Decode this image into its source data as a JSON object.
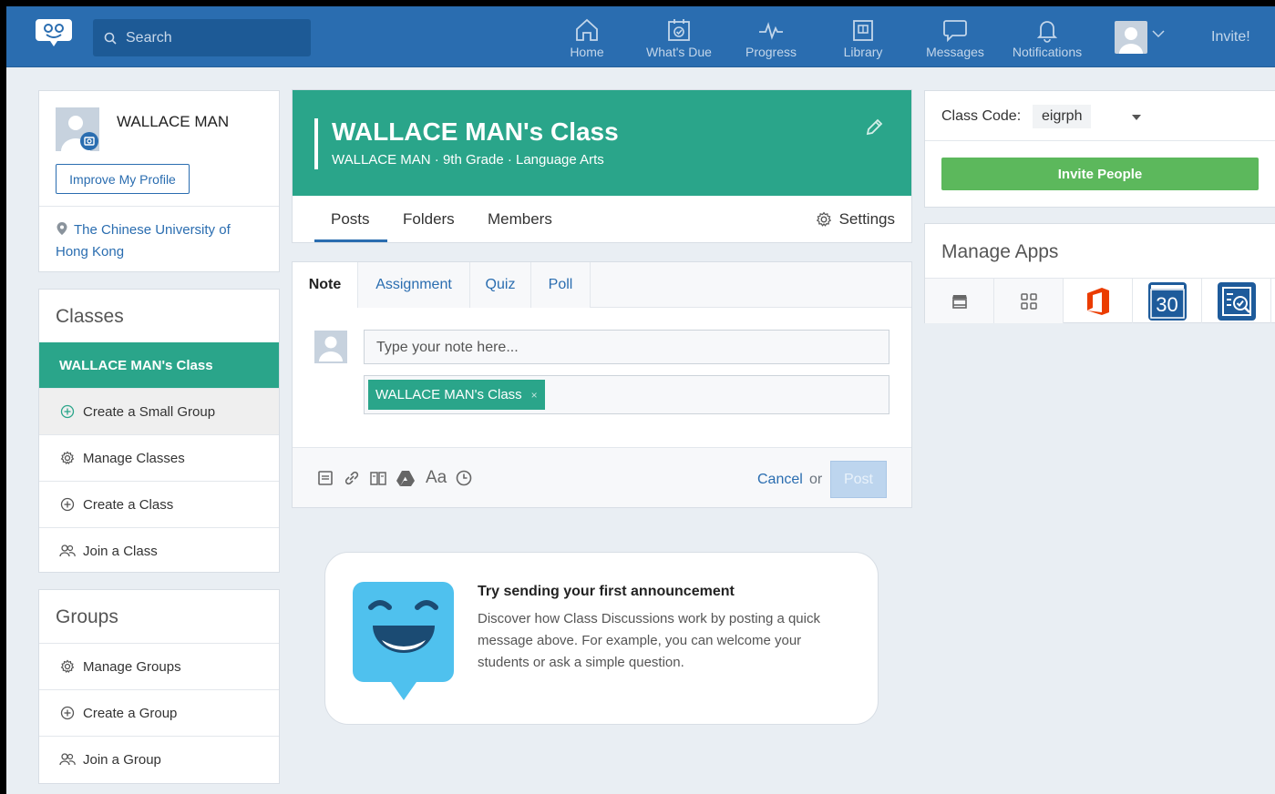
{
  "header": {
    "search_placeholder": "Search",
    "nav": [
      {
        "label": "Home",
        "icon": "home-icon"
      },
      {
        "label": "What's Due",
        "icon": "calendar-check-icon"
      },
      {
        "label": "Progress",
        "icon": "pulse-icon"
      },
      {
        "label": "Library",
        "icon": "library-icon"
      },
      {
        "label": "Messages",
        "icon": "chat-bubble-icon"
      },
      {
        "label": "Notifications",
        "icon": "bell-icon"
      }
    ],
    "invite_label": "Invite!"
  },
  "profile": {
    "name": "WALLACE MAN",
    "improve_label": "Improve My Profile",
    "school": "The Chinese University of Hong Kong"
  },
  "classes": {
    "heading": "Classes",
    "active_class": "WALLACE MAN's Class",
    "items": [
      {
        "label": "Create a Small Group",
        "icon": "plus-circle-icon"
      },
      {
        "label": "Manage Classes",
        "icon": "gear-icon"
      },
      {
        "label": "Create a Class",
        "icon": "plus-circle-icon"
      },
      {
        "label": "Join a Class",
        "icon": "people-icon"
      }
    ]
  },
  "groups": {
    "heading": "Groups",
    "items": [
      {
        "label": "Manage Groups",
        "icon": "gear-icon"
      },
      {
        "label": "Create a Group",
        "icon": "plus-circle-icon"
      },
      {
        "label": "Join a Group",
        "icon": "people-icon"
      }
    ]
  },
  "classhead": {
    "title": "WALLACE MAN's Class",
    "subtitle": "WALLACE MAN · 9th Grade · Language Arts",
    "tabs": [
      "Posts",
      "Folders",
      "Members"
    ],
    "settings_label": "Settings"
  },
  "composer": {
    "tabs": [
      "Note",
      "Assignment",
      "Quiz",
      "Poll"
    ],
    "placeholder": "Type your note here...",
    "tag": "WALLACE MAN's Class",
    "tag_remove": "×",
    "cancel": "Cancel",
    "or": "or",
    "post": "Post",
    "font_tool": "Aa"
  },
  "announce": {
    "title": "Try sending your first announcement",
    "body": "Discover how Class Discussions work by posting a quick message above. For example, you can welcome your students or ask a simple question."
  },
  "classcode": {
    "label": "Class Code:",
    "value": "eigrph",
    "invite_label": "Invite People"
  },
  "apps": {
    "heading": "Manage Apps",
    "icons": [
      "store-icon",
      "apps-grid-icon",
      "office-icon",
      "calendar-30-icon",
      "quiz-app-icon"
    ],
    "calendar_number": "30"
  },
  "colors": {
    "brand_blue": "#2a6db0",
    "class_green": "#2aa58a",
    "invite_green": "#5cb85c"
  }
}
